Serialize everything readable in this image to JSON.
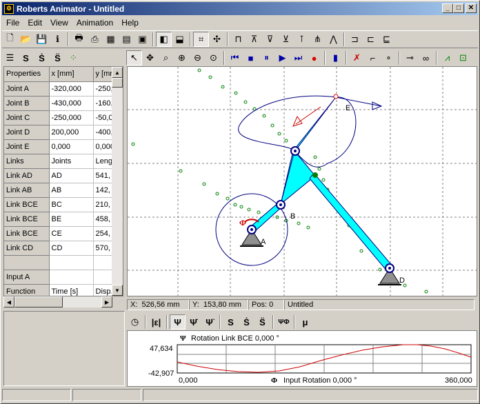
{
  "window": {
    "title": "Roberts Animator - Untitled"
  },
  "menu": {
    "file": "File",
    "edit": "Edit",
    "view": "View",
    "animation": "Animation",
    "help": "Help"
  },
  "grid": {
    "header": [
      "Properties",
      "x [mm]",
      "y [mr"
    ],
    "rows": [
      [
        "Joint A",
        "-320,000",
        "-250,"
      ],
      [
        "Joint B",
        "-430,000",
        "-160,"
      ],
      [
        "Joint C",
        "-250,000",
        "-50,0"
      ],
      [
        "Joint D",
        "200,000",
        "-400,"
      ],
      [
        "Joint E",
        "0,000",
        "0,000"
      ],
      [
        "Links",
        "Joints",
        "Leng"
      ],
      [
        "Link AD",
        "AD",
        "541,"
      ],
      [
        "Link AB",
        "AB",
        "142,"
      ],
      [
        "Link BCE",
        "BC",
        "210,"
      ],
      [
        "Link BCE",
        "BE",
        "458,"
      ],
      [
        "Link BCE",
        "CE",
        "254,"
      ],
      [
        "Link CD",
        "CD",
        "570,"
      ],
      [
        "",
        "",
        ""
      ],
      [
        "Input A",
        "",
        ""
      ],
      [
        "Function",
        "Time [s]",
        "Disp."
      ]
    ]
  },
  "labels": {
    "A": "A",
    "B": "B",
    "D": "D",
    "E": "E"
  },
  "status": {
    "x_label": "X:",
    "x_value": "526,56 mm",
    "y_label": "Y:",
    "y_value": "153,80 mm",
    "pos": "Pos: 0",
    "file": "Untitled"
  },
  "diagram": {
    "title": "Rotation Link BCE 0,000 °",
    "ymax": "47,634",
    "ymin": "-42,907",
    "xmin": "0,000",
    "xmax": "360,000",
    "xtitle": "Input Rotation 0,000 °"
  },
  "colors": {
    "link": "#00ffff",
    "curve": "#000080",
    "arrow": "#cc0000",
    "dots": "#008000"
  }
}
